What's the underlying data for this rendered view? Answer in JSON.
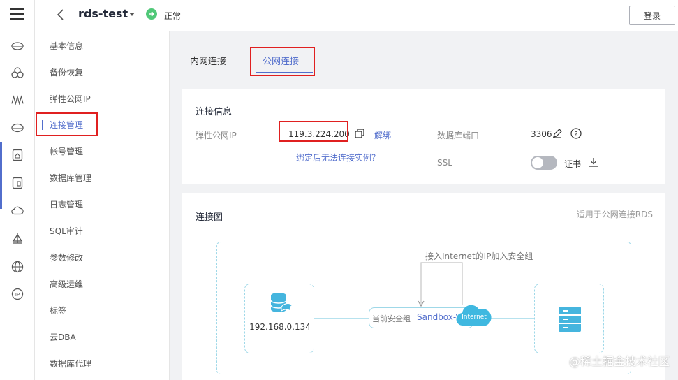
{
  "header": {
    "title": "rds-test",
    "status": "正常",
    "login_label": "登录"
  },
  "subnav": {
    "items": [
      "基本信息",
      "备份恢复",
      "弹性公网IP",
      "连接管理",
      "帐号管理",
      "数据库管理",
      "日志管理",
      "SQL审计",
      "参数修改",
      "高级运维",
      "标签",
      "云DBA",
      "数据库代理"
    ],
    "active_index": 3
  },
  "tabs": [
    "内网连接",
    "公网连接"
  ],
  "active_tab": 1,
  "connection_info": {
    "title": "连接信息",
    "eip_label": "弹性公网IP",
    "eip_value": "119.3.224.200",
    "unbind_link": "解绑",
    "cannot_connect_link": "绑定后无法连接实例？",
    "port_label": "数据库端口",
    "port_value": "3306",
    "ssl_label": "SSL",
    "ssl_enabled": false,
    "cert_label": "证书"
  },
  "diagram": {
    "title": "连接图",
    "note": "适用于公网连接RDS",
    "loop_label": "接入Internet的IP加入安全组",
    "client_ip": "192.168.0.134",
    "sg_label": "当前安全组",
    "sg_name": "Sandbox-V",
    "cloud_label": "Internet"
  },
  "watermark": "@稀土掘金技术社区",
  "colors": {
    "accent": "#526ecc",
    "highlight_border": "#e02020",
    "status_ok": "#50c878",
    "diagram_line": "#9fd8e8",
    "cloud": "#3fb8e0",
    "db_icon": "#45b5de"
  },
  "icons": [
    "menu-icon",
    "cloud-host-icon",
    "cluster-icon",
    "waveform-icon",
    "disk-icon",
    "house-icon",
    "doc-icon",
    "cloud-icon",
    "boat-icon",
    "globe-icon",
    "ip-icon"
  ]
}
